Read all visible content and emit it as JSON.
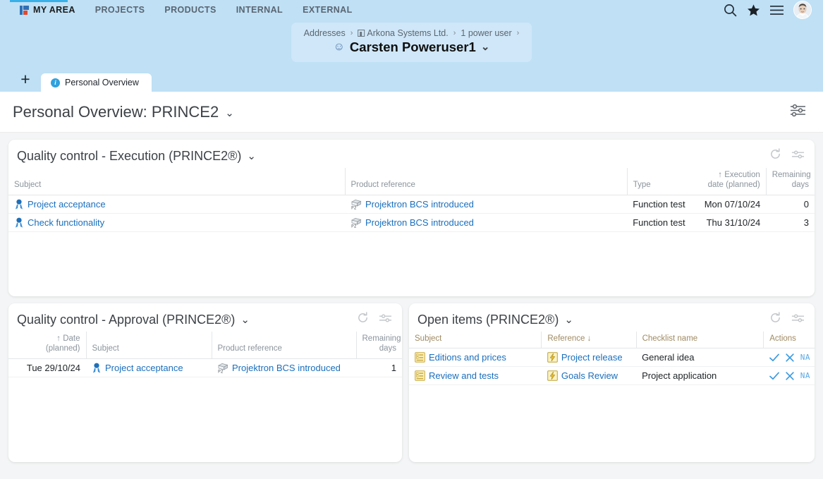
{
  "top_nav": {
    "items": [
      {
        "label": "MY AREA",
        "icon": "myarea-icon",
        "active": true
      },
      {
        "label": "PROJECTS",
        "active": false
      },
      {
        "label": "PRODUCTS",
        "active": false
      },
      {
        "label": "INTERNAL",
        "active": false
      },
      {
        "label": "EXTERNAL",
        "active": false
      }
    ],
    "right_icons": [
      {
        "name": "search-icon",
        "glyph": "search"
      },
      {
        "name": "favorites-star-icon",
        "glyph": "star"
      },
      {
        "name": "menu-hamburger-icon",
        "glyph": "menu"
      },
      {
        "name": "user-avatar",
        "glyph": "avatar"
      }
    ]
  },
  "breadcrumb": {
    "path": [
      {
        "label": "Addresses",
        "icon": null
      },
      {
        "label": "Arkona Systems Ltd.",
        "icon": "card-icon"
      },
      {
        "label": "1 power user",
        "icon": null
      }
    ],
    "separator": "›",
    "title": "Carsten Poweruser1",
    "title_icon": "person-icon",
    "title_caret": "⌄"
  },
  "tabs": {
    "add_label": "+",
    "items": [
      {
        "label": "Personal Overview",
        "icon": "info-icon",
        "active": true
      }
    ]
  },
  "page": {
    "title": "Personal Overview: PRINCE2",
    "title_caret": "⌄",
    "settings_icon": "sliders-icon"
  },
  "panels": {
    "execution": {
      "title": "Quality control - Execution (PRINCE2®)",
      "caret": "⌄",
      "tools": [
        {
          "name": "refresh-icon"
        },
        {
          "name": "sliders-icon"
        }
      ],
      "columns": [
        {
          "label": "Subject",
          "align": "left"
        },
        {
          "label": "Product reference",
          "align": "left"
        },
        {
          "label": "Type",
          "align": "left"
        },
        {
          "label": "↑ Execution\ndate (planned)",
          "align": "right",
          "sort": "asc"
        },
        {
          "label": "Remaining\ndays",
          "align": "right"
        }
      ],
      "rows": [
        {
          "subject": "Project acceptance",
          "subject_icon": "quality-ribbon-icon",
          "product_reference": "Projektron BCS introduced",
          "product_icon": "product-p2-icon",
          "type": "Function test",
          "execution_date": "Mon 07/10/24",
          "remaining_days": "0"
        },
        {
          "subject": "Check functionality",
          "subject_icon": "quality-ribbon-icon",
          "product_reference": "Projektron BCS introduced",
          "product_icon": "product-p2-icon",
          "type": "Function test",
          "execution_date": "Thu 31/10/24",
          "remaining_days": "3"
        }
      ]
    },
    "approval": {
      "title": "Quality control - Approval (PRINCE2®)",
      "caret": "⌄",
      "tools": [
        {
          "name": "refresh-icon"
        },
        {
          "name": "sliders-icon"
        }
      ],
      "columns": [
        {
          "label": "↑ Date\n(planned)",
          "align": "right",
          "sort": "asc"
        },
        {
          "label": "Subject",
          "align": "left"
        },
        {
          "label": "Product reference",
          "align": "left"
        },
        {
          "label": "Remaining\ndays",
          "align": "right"
        }
      ],
      "rows": [
        {
          "date": "Tue 29/10/24",
          "subject": "Project acceptance",
          "subject_icon": "quality-ribbon-icon",
          "product_reference": "Projektron BCS introduced",
          "product_icon": "product-p2-icon",
          "remaining_days": "1"
        }
      ]
    },
    "open_items": {
      "title": "Open items (PRINCE2®)",
      "caret": "⌄",
      "tools": [
        {
          "name": "refresh-icon"
        },
        {
          "name": "sliders-icon"
        }
      ],
      "columns": [
        {
          "label": "Subject",
          "align": "left"
        },
        {
          "label": "Reference ↓",
          "align": "left",
          "sort": "desc"
        },
        {
          "label": "Checklist name",
          "align": "left"
        },
        {
          "label": "Actions",
          "align": "left"
        }
      ],
      "rows": [
        {
          "subject": "Editions and prices",
          "subject_icon": "checklist-icon",
          "reference": "Project release",
          "reference_icon": "milestone-icon",
          "checklist_name": "General idea",
          "actions": [
            {
              "name": "accept-check-action",
              "glyph": "✓"
            },
            {
              "name": "reject-x-action",
              "glyph": "✕"
            },
            {
              "name": "not-applicable-action",
              "glyph": "NA"
            }
          ]
        },
        {
          "subject": "Review and tests",
          "subject_icon": "checklist-icon",
          "reference": "Goals Review",
          "reference_icon": "milestone-icon",
          "checklist_name": "Project application",
          "actions": [
            {
              "name": "accept-check-action",
              "glyph": "✓"
            },
            {
              "name": "reject-x-action",
              "glyph": "✕"
            },
            {
              "name": "not-applicable-action",
              "glyph": "NA"
            }
          ]
        }
      ]
    }
  },
  "colors": {
    "nav_band": "#bfe0f5",
    "nav_accent": "#3ab0e8",
    "link": "#1a6fbd",
    "content_bg": "#f4f5f6",
    "action_blue": "#3d9be0",
    "openitems_header": "#a08a62"
  }
}
